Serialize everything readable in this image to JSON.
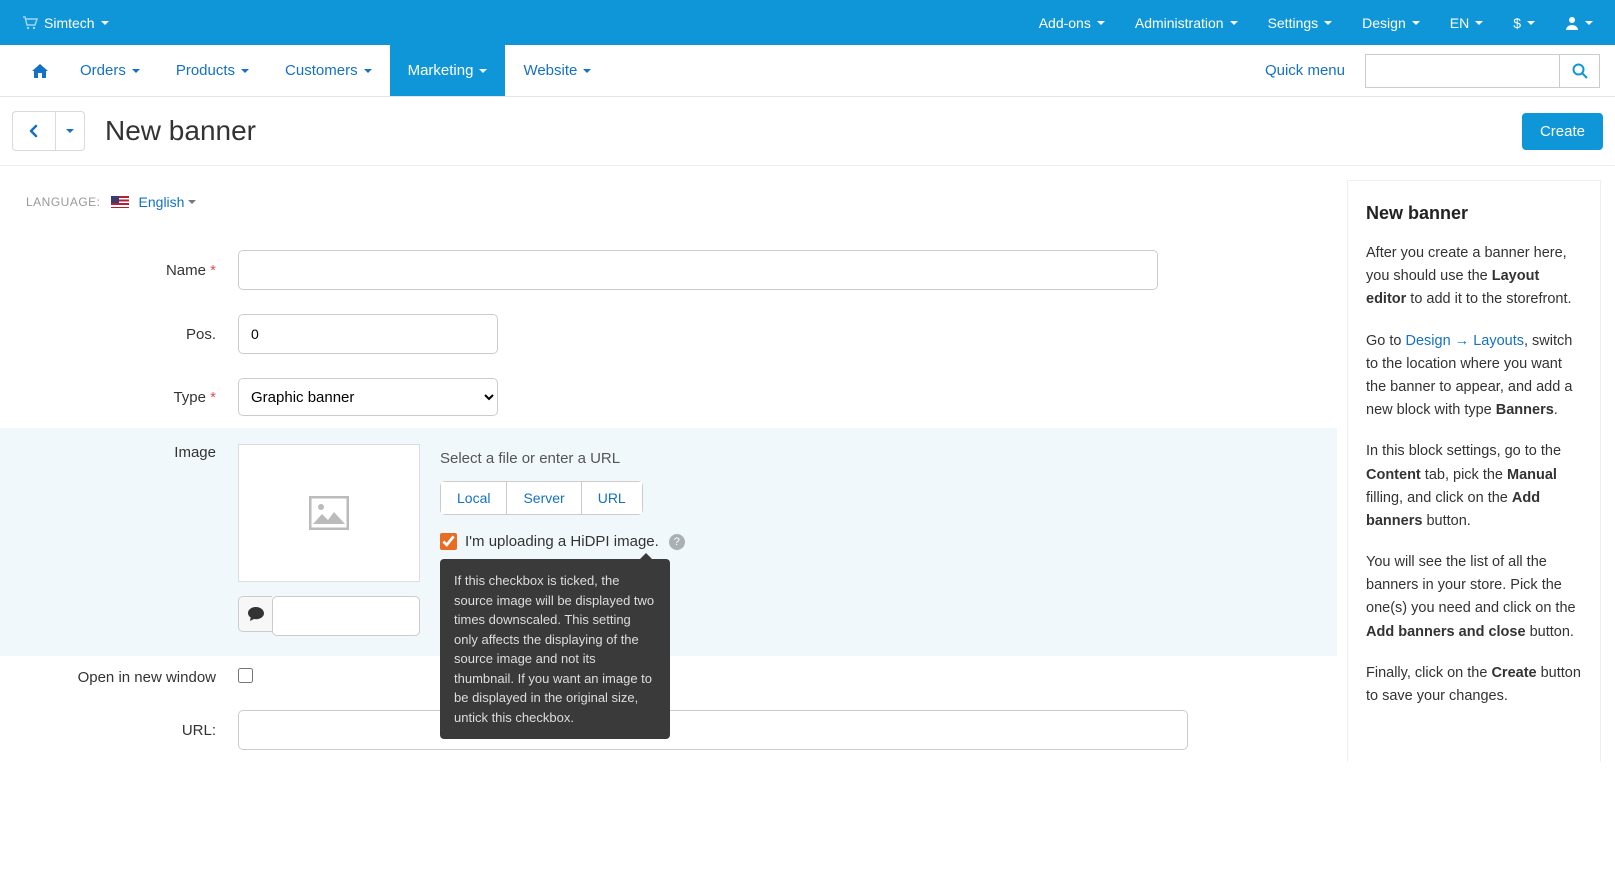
{
  "topbar": {
    "brand": "Simtech",
    "menu": [
      "Add-ons",
      "Administration",
      "Settings",
      "Design",
      "EN",
      "$"
    ]
  },
  "mainnav": {
    "tabs": [
      "Orders",
      "Products",
      "Customers",
      "Marketing",
      "Website"
    ],
    "quickmenu": "Quick menu"
  },
  "header": {
    "title": "New banner",
    "create": "Create"
  },
  "lang": {
    "label": "LANGUAGE:",
    "value": "English"
  },
  "form": {
    "name_label": "Name",
    "pos_label": "Pos.",
    "pos_value": "0",
    "type_label": "Type",
    "type_value": "Graphic banner",
    "image_label": "Image",
    "upload_title": "Select a file or enter a URL",
    "btn_local": "Local",
    "btn_server": "Server",
    "btn_url": "URL",
    "hidpi_label": "I'm uploading a HiDPI image.",
    "tooltip": "If this checkbox is ticked, the source image will be displayed two times downscaled. This setting only affects the displaying of the source image and not its thumbnail. If you want an image to be displayed in the original size, untick this checkbox.",
    "open_label": "Open in new window",
    "url_label": "URL:"
  },
  "sidebar": {
    "title": "New banner",
    "p1a": "After you create a banner here, you should use the ",
    "p1b": "Layout editor",
    "p1c": " to add it to the storefront.",
    "p2a": "Go to ",
    "p2link": "Design → Layouts",
    "p2b": ", switch to the location where you want the banner to appear, and add a new block with type ",
    "p2c": "Banners",
    "p3a": "In this block settings, go to the ",
    "p3b": "Content",
    "p3c": " tab, pick the ",
    "p3d": "Manual",
    "p3e": " filling, and click on the ",
    "p3f": "Add banners",
    "p3g": " button.",
    "p4a": "You will see the list of all the banners in your store. Pick the one(s) you need and click on the ",
    "p4b": "Add banners and close",
    "p4c": " button.",
    "p5a": "Finally, click on the ",
    "p5b": "Create",
    "p5c": " button to save your changes."
  }
}
